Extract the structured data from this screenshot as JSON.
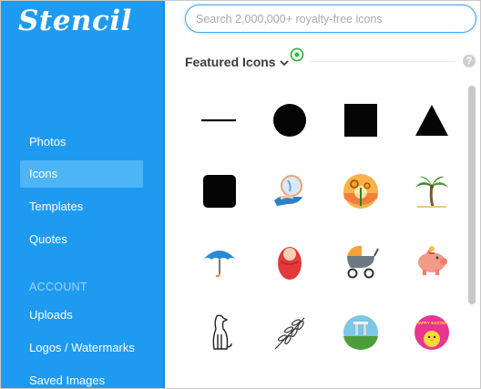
{
  "app": {
    "logo_text": "Stencil"
  },
  "sidebar": {
    "items": [
      {
        "label": "Photos",
        "active": false
      },
      {
        "label": "Icons",
        "active": true
      },
      {
        "label": "Templates",
        "active": false
      },
      {
        "label": "Quotes",
        "active": false
      }
    ],
    "account_heading": "ACCOUNT",
    "account_items": [
      {
        "label": "Uploads"
      },
      {
        "label": "Logos / Watermarks"
      },
      {
        "label": "Saved Images"
      }
    ]
  },
  "search": {
    "placeholder": "Search 2,000,000+ royalty-free icons",
    "value": ""
  },
  "section": {
    "title": "Featured Icons",
    "help": "?"
  },
  "icons": [
    "horizontal-line-icon",
    "filled-circle-icon",
    "filled-square-icon",
    "filled-triangle-icon",
    "rounded-square-icon",
    "hand-with-globe-icon",
    "sunset-sunflower-icon",
    "palm-tree-icon",
    "umbrella-icon",
    "baby-swaddle-icon",
    "baby-stroller-icon",
    "piggy-bank-icon",
    "dog-sitting-icon",
    "olive-branch-icon",
    "landscape-circle-icon",
    "easter-chick-badge-icon"
  ],
  "easter_badge_text": "HAPPY EASTER",
  "colors": {
    "sidebar_bg": "#1e9bf0",
    "active_item_bg": "#4db4f5",
    "search_border": "#4aa3e8",
    "target_green": "#3cb54a"
  }
}
